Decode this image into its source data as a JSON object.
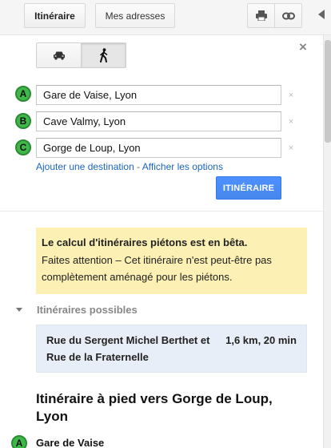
{
  "toolbar": {
    "itineraire_label": "Itinéraire",
    "adresses_label": "Mes adresses",
    "print_icon": "printer-icon",
    "link_icon": "link-icon"
  },
  "modes": {
    "car_icon": "car-icon",
    "walk_icon": "walking-person-icon",
    "selected": "walk"
  },
  "waypoints": [
    {
      "marker": "A",
      "value": "Gare de Vaise, Lyon"
    },
    {
      "marker": "B",
      "value": "Cave Valmy, Lyon"
    },
    {
      "marker": "C",
      "value": "Gorge de Loup, Lyon"
    }
  ],
  "links": {
    "add_destination": "Ajouter une destination",
    "separator": " - ",
    "show_options": "Afficher les options"
  },
  "route_button": "ITINÉRAIRE",
  "beta_notice": {
    "title": "Le calcul d'itinéraires piétons est en bêta.",
    "body": "Faites attention – Cet itinéraire n'est peut-être pas complètement aménagé pour les piétons."
  },
  "routes": {
    "header": "Itinéraires possibles",
    "items": [
      {
        "name": "Rue du Sergent Michel Berthet et Rue de la Fraternelle",
        "meta": "1,6 km, 20 min"
      }
    ]
  },
  "directions": {
    "title": "Itinéraire à pied vers Gorge de Loup, Lyon",
    "start_marker": "A",
    "start_label": "Gare de Vaise"
  },
  "colors": {
    "accent_blue": "#4787ed",
    "marker_green": "#3fb84a",
    "beta_yellow": "#fcf0b4",
    "route_highlight": "#e8eef7"
  }
}
